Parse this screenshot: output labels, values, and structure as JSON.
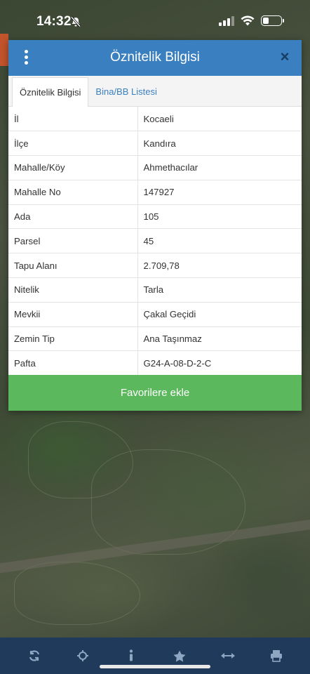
{
  "status": {
    "time": "14:32"
  },
  "dialog": {
    "title": "Öznitelik Bilgisi",
    "close_label": "×",
    "tabs": [
      {
        "label": "Öznitelik Bilgisi",
        "active": true
      },
      {
        "label": "Bina/BB Listesi",
        "active": false
      }
    ],
    "rows": [
      {
        "key": "İl",
        "value": "Kocaeli"
      },
      {
        "key": "İlçe",
        "value": "Kandıra"
      },
      {
        "key": "Mahalle/Köy",
        "value": "Ahmethacılar"
      },
      {
        "key": "Mahalle No",
        "value": "147927"
      },
      {
        "key": "Ada",
        "value": "105"
      },
      {
        "key": "Parsel",
        "value": "45"
      },
      {
        "key": "Tapu Alanı",
        "value": "2.709,78"
      },
      {
        "key": "Nitelik",
        "value": "Tarla"
      },
      {
        "key": "Mevkii",
        "value": "Çakal Geçidi"
      },
      {
        "key": "Zemin Tip",
        "value": "Ana Taşınmaz"
      },
      {
        "key": "Pafta",
        "value": "G24-A-08-D-2-C"
      }
    ],
    "favorite_button": "Favorilere ekle"
  },
  "toolbar": {
    "icons": [
      "refresh-icon",
      "locate-icon",
      "info-icon",
      "star-icon",
      "measure-icon",
      "print-icon"
    ]
  },
  "colors": {
    "header": "#3a7fc0",
    "favorite": "#5cb85c",
    "toolbar": "#1f3a5a",
    "toolbar_icon": "#8ea6c2"
  }
}
